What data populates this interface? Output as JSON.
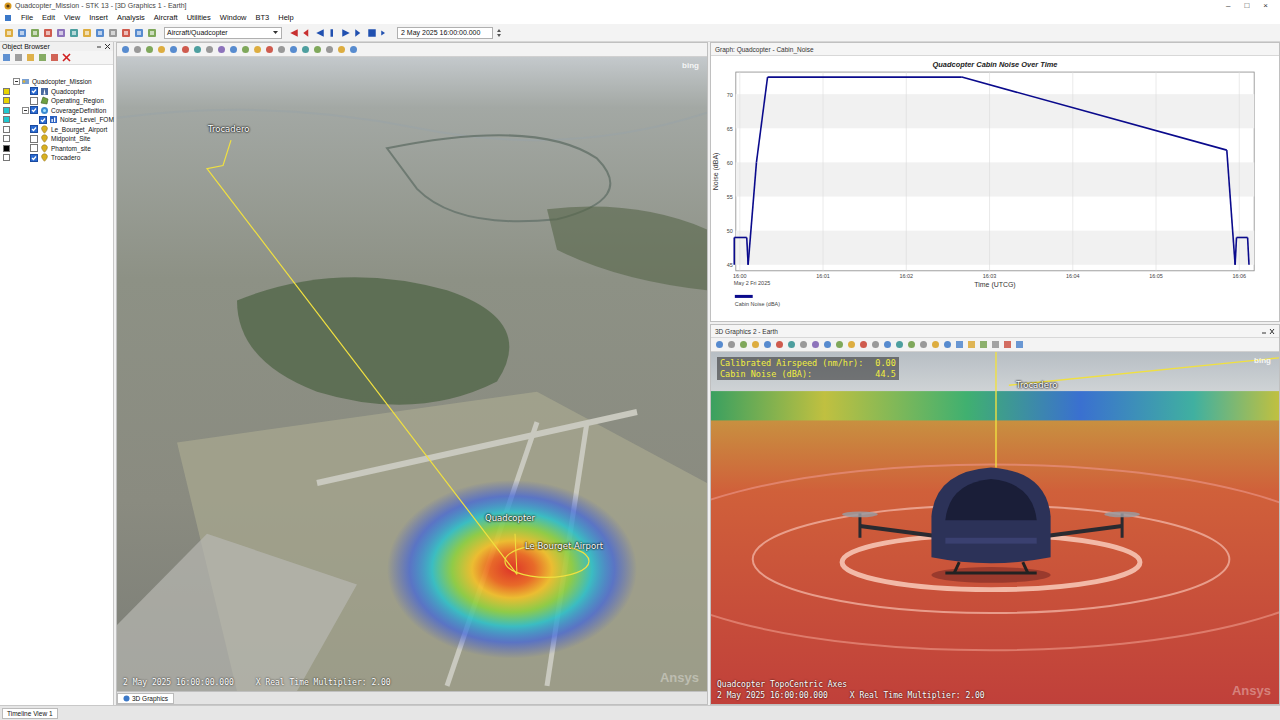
{
  "window": {
    "title": "Quadcopter_Mission - STK 13 - [3D Graphics 1 - Earth]",
    "controls": [
      "–",
      "□",
      "×"
    ]
  },
  "menu": [
    "File",
    "Edit",
    "View",
    "Insert",
    "Analysis",
    "Aircraft",
    "Utilities",
    "Window",
    "BT3",
    "Help"
  ],
  "toolbar": {
    "object_selector": "Aircraft/Quadcopter",
    "time": "2 May 2025 16:00:00.000"
  },
  "object_browser": {
    "title": "Object Browser",
    "root": {
      "label": "Quadcopter_Mission",
      "kind": "scenario",
      "expanded": true,
      "children": [
        {
          "label": "Quadcopter",
          "kind": "aircraft",
          "checked": true,
          "color": "#e8d400"
        },
        {
          "label": "Operating_Region",
          "kind": "area",
          "checked": false,
          "color": "#e8d400"
        },
        {
          "label": "CoverageDefinition",
          "kind": "coverage",
          "checked": true,
          "color": "#20c8d0",
          "expanded": true,
          "children": [
            {
              "label": "Noise_Level_FOM",
              "kind": "fom",
              "checked": true,
              "color": "#20c8d0"
            }
          ]
        },
        {
          "label": "Le_Bourget_Airport",
          "kind": "place",
          "checked": true,
          "color": "#ffffff"
        },
        {
          "label": "Midpoint_Site",
          "kind": "place",
          "checked": false,
          "color": "#ffffff"
        },
        {
          "label": "Phantom_site",
          "kind": "place",
          "checked": false,
          "color": "#000000"
        },
        {
          "label": "Trocadero",
          "kind": "place",
          "checked": true,
          "color": "#ffffff"
        }
      ]
    }
  },
  "view_main": {
    "tab": "3D Graphics",
    "labels": {
      "trocadero": "Trocadero",
      "quadcopter": "Quadcopter",
      "airport": "Le Bourget Airport"
    },
    "time": "2 May 2025 16:00:00.000",
    "multiplier": "X Real Time Multiplier: 2.00",
    "bing": "bing",
    "watermark": "Ansys"
  },
  "graph": {
    "window_title": "Graph: Quadcopter - Cabin_Noise",
    "title": "Quadcopter Cabin Noise Over Time",
    "y_label": "Noise (dBA)",
    "x_label": "Time (UTCG)",
    "date": "May 2 Fri 2025",
    "y_ticks": [
      "45",
      "50",
      "55",
      "60",
      "65",
      "70"
    ],
    "x_ticks": [
      "16:00",
      "16:01",
      "16:02",
      "16:03",
      "16:04",
      "16:05",
      "16:06"
    ],
    "series": [
      {
        "name": "Cabin Noise (dBA)",
        "color": "#0a0a8c",
        "x_seconds": [
          -4,
          -4,
          5,
          6,
          12,
          20,
          160,
          351,
          357,
          358,
          366,
          367
        ],
        "values": [
          45,
          49,
          49,
          45,
          60,
          72.5,
          72.5,
          61.8,
          45,
          49,
          49,
          45
        ]
      }
    ]
  },
  "view_second": {
    "window_title": "3D Graphics 2 - Earth",
    "overlay": [
      {
        "label": "Calibrated Airspeed (nm/hr):",
        "value": "0.00"
      },
      {
        "label": "Cabin Noise (dBA):",
        "value": "44.5"
      }
    ],
    "label": "Trocadero",
    "axes": "Quadcopter TopoCentric Axes",
    "time": "2 May 2025 16:00:00.000",
    "multiplier": "X Real Time Multiplier: 2.00",
    "bing": "bing",
    "watermark": "Ansys"
  },
  "status_bar": {
    "tab": "Timeline View 1"
  }
}
